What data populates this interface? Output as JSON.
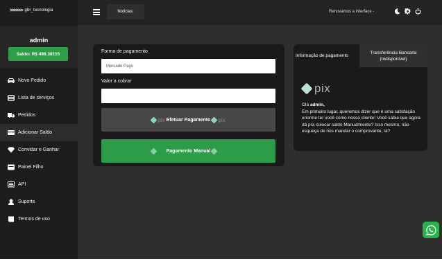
{
  "brand": {
    "arrows": ">>>>>>",
    "name": "gbr_tecnologia"
  },
  "user": {
    "name": "admin",
    "balance": "Saldo: R$ 498.38115"
  },
  "sidebar": {
    "items": [
      {
        "label": "Novo Pedido",
        "icon": "car-icon"
      },
      {
        "label": "Lista de serviços",
        "icon": "list-icon"
      },
      {
        "label": "Pedidos",
        "icon": "truck-icon"
      },
      {
        "label": "Adicionar Saldo",
        "icon": "wallet-icon"
      },
      {
        "label": "Convidar e Ganhar",
        "icon": "diamond-icon"
      },
      {
        "label": "Painel Filho",
        "icon": "panel-icon"
      },
      {
        "label": "API",
        "icon": "keyboard-icon"
      },
      {
        "label": "Suporte",
        "icon": "support-icon"
      },
      {
        "label": "Termos de uso",
        "icon": "book-icon"
      }
    ],
    "active_index": 3
  },
  "topbar": {
    "news_label": "Notícias:",
    "marquee": "Renovamos a interface -",
    "icons": [
      "moon-icon",
      "gear-icon",
      "power-icon"
    ]
  },
  "payment": {
    "method_label": "Forma de pagamento",
    "method_value": "Mercado Pago",
    "amount_label": "Valor a cobrar",
    "amount_value": "",
    "pix_button": "Efetuar Pagamento",
    "manual_button": "Pagamento Manual",
    "pix_word": "pix"
  },
  "info": {
    "tab_info": "Informação de pagamento",
    "tab_transfer": "Transferência Bancaria (Indisponível)",
    "pix_word": "pix",
    "greeting_prefix": "Olá",
    "greeting_name": "admin,",
    "message": "Em primeiro lugar, queremos dizer que é uma satisfação enorme ter você como nosso cliente! Você sabia que agora dá pra colocar saldo Manualmente? Isso mesmo, não esqueça de nos mandar o comprovante, tá?"
  },
  "colors": {
    "accent": "#2e9e49",
    "sidebar": "#1d1d1d",
    "content": "#2e2e2e",
    "card": "#1a1a1a"
  }
}
